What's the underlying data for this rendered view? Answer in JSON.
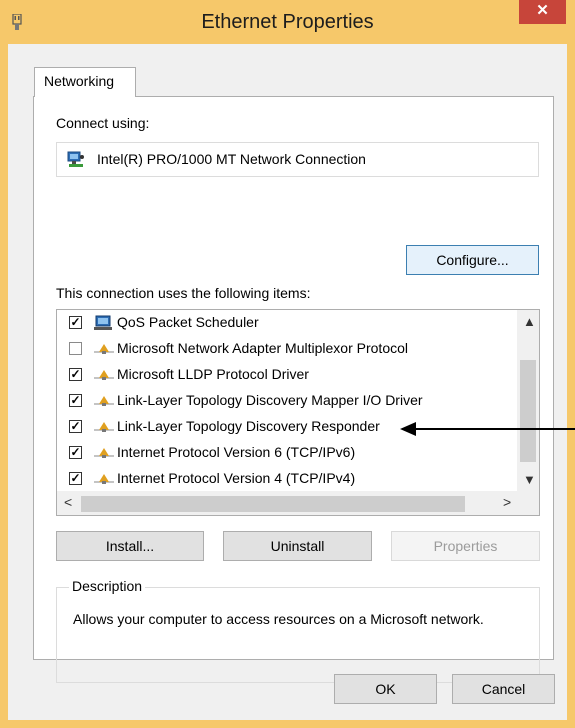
{
  "window": {
    "title": "Ethernet Properties",
    "close_glyph": "✕"
  },
  "tabs": [
    {
      "label": "Networking",
      "selected": true
    }
  ],
  "connect": {
    "label": "Connect using:",
    "adapter": "Intel(R) PRO/1000 MT Network Connection",
    "configure_button": "Configure..."
  },
  "items": {
    "label": "This connection uses the following items:",
    "list": [
      {
        "checked": true,
        "label": "QoS Packet Scheduler",
        "icon": "computer-icon"
      },
      {
        "checked": false,
        "label": "Microsoft Network Adapter Multiplexor Protocol",
        "icon": "protocol-icon"
      },
      {
        "checked": true,
        "label": "Microsoft LLDP Protocol Driver",
        "icon": "protocol-icon"
      },
      {
        "checked": true,
        "label": "Link-Layer Topology Discovery Mapper I/O Driver",
        "icon": "protocol-icon"
      },
      {
        "checked": true,
        "label": "Link-Layer Topology Discovery Responder",
        "icon": "protocol-icon"
      },
      {
        "checked": true,
        "label": "Internet Protocol Version 6 (TCP/IPv6)",
        "icon": "protocol-icon"
      },
      {
        "checked": true,
        "label": "Internet Protocol Version 4 (TCP/IPv4)",
        "icon": "protocol-icon"
      }
    ]
  },
  "buttons": {
    "install": "Install...",
    "uninstall": "Uninstall",
    "properties": "Properties",
    "ok": "OK",
    "cancel": "Cancel"
  },
  "description": {
    "title": "Description",
    "text": "Allows your computer to access resources on a Microsoft network."
  },
  "colors": {
    "titlebar": "#f6c86a",
    "close_button": "#c7453a",
    "accent_border": "#3c7fb1"
  }
}
